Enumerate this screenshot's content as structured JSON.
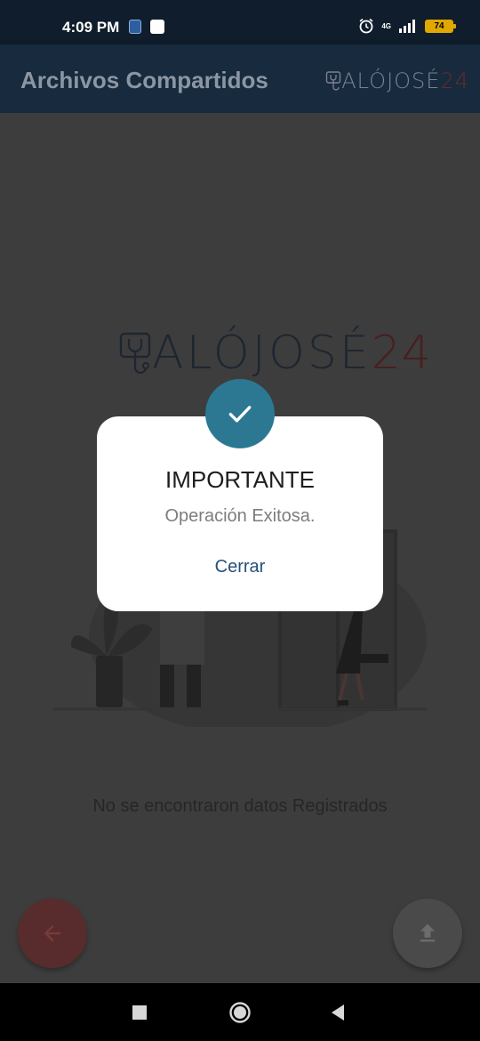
{
  "status_bar": {
    "time": "4:09 PM",
    "network": "4G",
    "battery": "74",
    "icons": [
      "sim-app-icon",
      "browser-app-icon",
      "alarm-icon",
      "signal-icon",
      "battery-icon"
    ]
  },
  "app_bar": {
    "title": "Archivos Compartidos",
    "logo_text": "ALÓJOSÉ",
    "logo_number": "24"
  },
  "content": {
    "logo_text": "ALÓJOSÉ",
    "logo_number": "24",
    "empty_message": "No se encontraron datos Registrados"
  },
  "dialog": {
    "title": "IMPORTANTE",
    "message": "Operación Exitosa.",
    "close_label": "Cerrar",
    "icon": "check-icon"
  },
  "fabs": {
    "back_icon": "arrow-back-icon",
    "upload_icon": "upload-icon"
  },
  "nav": {
    "icons": [
      "recents-icon",
      "home-icon",
      "back-icon"
    ]
  },
  "colors": {
    "app_bar": "#172a3e",
    "status_bar": "#0f1d2c",
    "dialog_accent": "#2c7893",
    "link": "#24517a",
    "logo_red": "#c0392b"
  }
}
